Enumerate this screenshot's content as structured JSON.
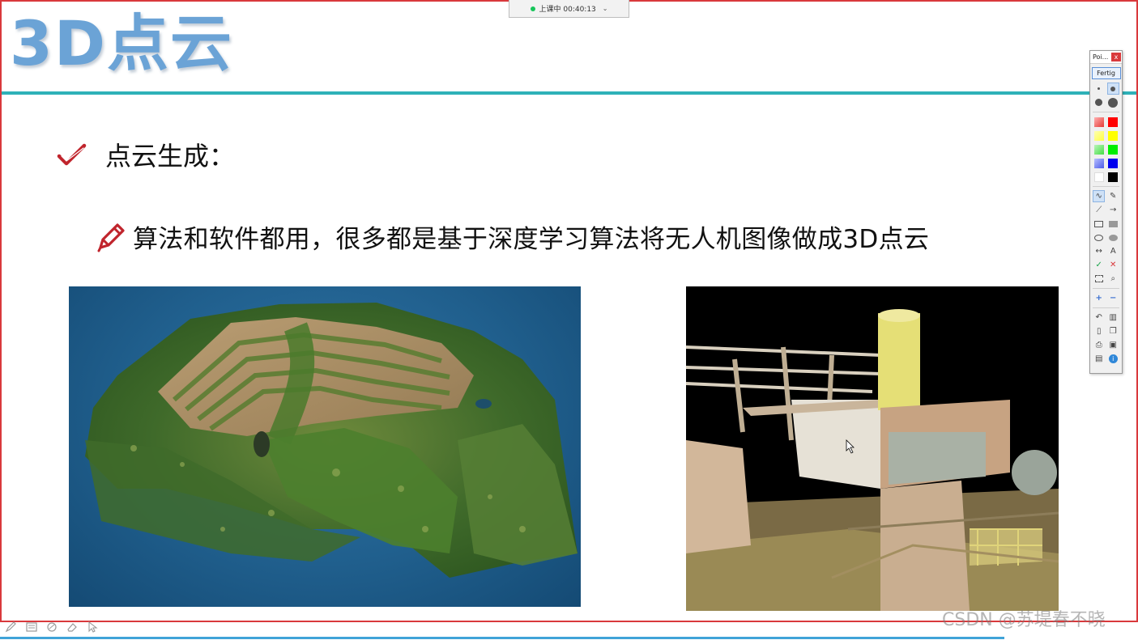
{
  "timer": {
    "label": "上课中 00:40:13",
    "status_color": "#17c55a"
  },
  "slide": {
    "title": "3D点云",
    "bullet1": "点云生成：",
    "bullet2": "算法和软件都用，很多都是基于深度学习算法将无人机图像做成3D点云",
    "accent_title": "#6ba3d6",
    "accent_rule": "#2fb1b8",
    "accent_icon": "#c0242c"
  },
  "palette": {
    "title": "Poi...",
    "close": "x",
    "done_label": "Fertig",
    "colors": [
      "#e53935",
      "#ff0000",
      "#ffff44",
      "#ffff00",
      "#44dd44",
      "#00ee00",
      "#4c5be8",
      "#0000ee",
      "#ffffff",
      "#000000"
    ],
    "text_tool": "A"
  },
  "watermark": "CSDN @苏堤春不晓",
  "images": {
    "left": "aerial-point-cloud",
    "right": "industrial-point-cloud"
  }
}
